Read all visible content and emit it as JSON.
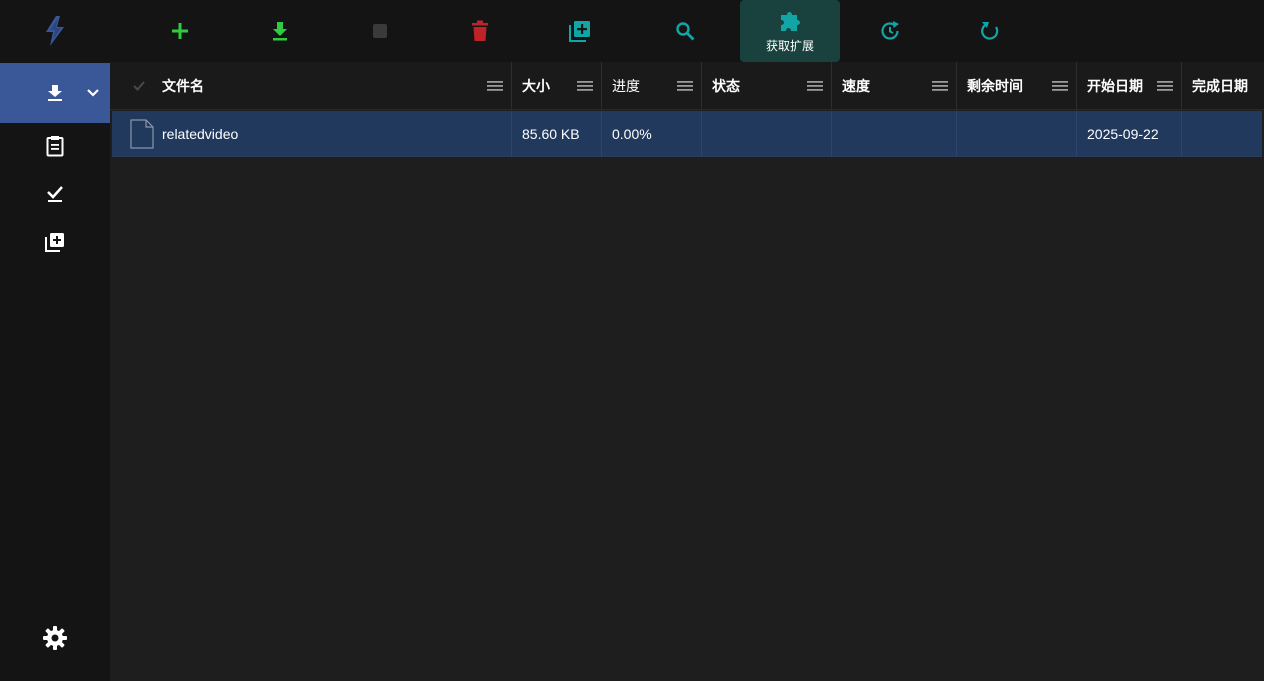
{
  "toolbar": {
    "items": [
      {
        "name": "add",
        "icon": "plus-icon",
        "color": "#2ecc40"
      },
      {
        "name": "download",
        "icon": "download-icon",
        "color": "#2ecc40"
      },
      {
        "name": "stop",
        "icon": "stop-icon",
        "color": "#3a3a3a"
      },
      {
        "name": "delete",
        "icon": "trash-icon",
        "color": "#c0222a"
      },
      {
        "name": "add-batch",
        "icon": "library-add-icon",
        "color": "#12a5a5"
      },
      {
        "name": "search",
        "icon": "search-icon",
        "color": "#12a5a5"
      },
      {
        "name": "extensions",
        "icon": "puzzle-icon",
        "color": "#12a5a5",
        "label": "获取扩展"
      },
      {
        "name": "history",
        "icon": "history-icon",
        "color": "#12a5a5"
      },
      {
        "name": "refresh",
        "icon": "refresh-icon",
        "color": "#12a5a5"
      }
    ]
  },
  "sidebar": {
    "items": [
      {
        "name": "downloading",
        "icon": "download-icon",
        "active": true
      },
      {
        "name": "queue",
        "icon": "clipboard-icon"
      },
      {
        "name": "completed",
        "icon": "check-icon"
      },
      {
        "name": "batch",
        "icon": "library-add-icon"
      }
    ],
    "settings_icon": "gear-icon",
    "accent": "#3a5898"
  },
  "table": {
    "columns": [
      "文件名",
      "大小",
      "进度",
      "状态",
      "速度",
      "剩余时间",
      "开始日期",
      "完成日期"
    ],
    "rows": [
      {
        "filename": "relatedvideo",
        "size": "85.60 KB",
        "progress": "0.00%",
        "status": "",
        "speed": "",
        "remaining": "",
        "start_date": "2025-09-22",
        "finish_date": ""
      }
    ]
  }
}
